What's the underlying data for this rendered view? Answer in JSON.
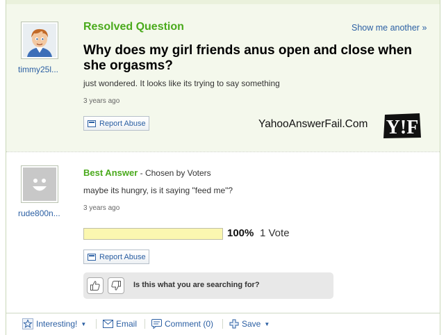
{
  "question": {
    "status_label": "Resolved Question",
    "show_another": "Show me another »",
    "title": "Why does my girl friends anus open and close when she orgasms?",
    "body": "just wondered. It looks like its trying to say something",
    "time": "3 years ago",
    "report_label": "Report Abuse",
    "asker": {
      "username": "timmy25l..."
    }
  },
  "watermark": {
    "site": "YahooAnswerFail.Com",
    "logo_text": "Y!F"
  },
  "answer": {
    "best_label": "Best Answer",
    "chosen_by": " - Chosen by Voters",
    "body": "maybe its hungry, is it saying \"feed me\"?",
    "time": "3 years ago",
    "report_label": "Report Abuse",
    "answerer": {
      "username": "rude800n..."
    },
    "vote_percent_label": "100%",
    "vote_fraction": 1.0,
    "vote_count_label": "1 Vote"
  },
  "feedback": {
    "prompt": "Is this what you are searching for?"
  },
  "bottom_bar": {
    "interesting": "Interesting!",
    "email": "Email",
    "comment": "Comment (0)",
    "save": "Save"
  },
  "colors": {
    "accent_green": "#4aaa1c",
    "link_blue": "#2b5fa3",
    "question_bg": "#f4f8ec",
    "vote_bar": "#fbf7b0"
  },
  "icons": [
    "flag-icon",
    "thumbs-up-icon",
    "thumbs-down-icon",
    "star-icon",
    "envelope-icon",
    "comment-icon",
    "plus-icon",
    "chevron-down-icon"
  ]
}
